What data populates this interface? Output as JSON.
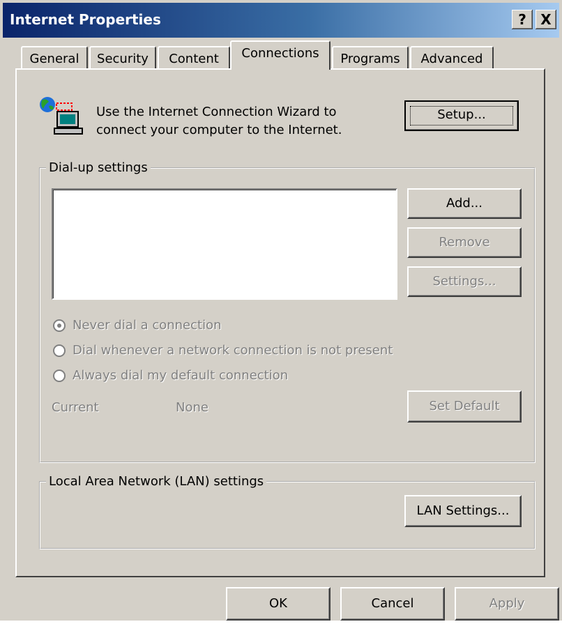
{
  "window": {
    "title": "Internet Properties",
    "help_glyph": "?",
    "close_glyph": "X"
  },
  "tabs": [
    {
      "label": "General"
    },
    {
      "label": "Security"
    },
    {
      "label": "Content"
    },
    {
      "label": "Connections",
      "active": true
    },
    {
      "label": "Programs"
    },
    {
      "label": "Advanced"
    }
  ],
  "wizard": {
    "line1": "Use the Internet Connection Wizard to",
    "line2": "connect your computer to the Internet.",
    "setup_label": "Setup..."
  },
  "dialup": {
    "group_label": "Dial-up settings",
    "add_label": "Add...",
    "remove_label": "Remove",
    "settings_label": "Settings...",
    "radios": [
      {
        "label": "Never dial a connection",
        "checked": true
      },
      {
        "label": "Dial whenever a network connection is not present",
        "checked": false
      },
      {
        "label": "Always dial my default connection",
        "checked": false
      }
    ],
    "current_label": "Current",
    "current_value": "None",
    "set_default_label": "Set Default"
  },
  "lan": {
    "group_label": "Local Area Network (LAN) settings",
    "lan_settings_label": "LAN Settings..."
  },
  "footer": {
    "ok_label": "OK",
    "cancel_label": "Cancel",
    "apply_label": "Apply"
  },
  "colors": {
    "face": "#d4d0c8",
    "titlebar_start": "#0a246a",
    "titlebar_end": "#a6caf0",
    "disabled_text": "#808080"
  }
}
